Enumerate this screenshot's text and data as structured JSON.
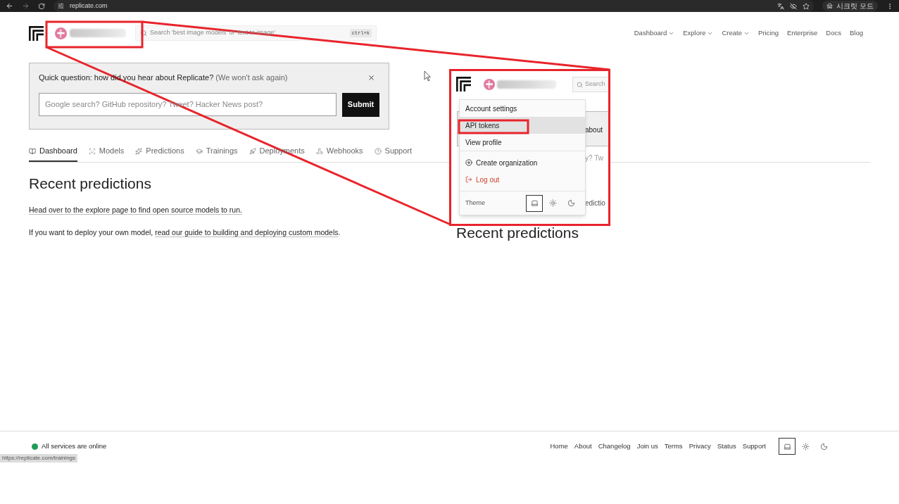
{
  "browser": {
    "url": "replicate.com",
    "profile_label": "시크릿 모드",
    "status_url": "https://replicate.com/trainings"
  },
  "header": {
    "search_placeholder": "Search 'best image models' or 'text to image'",
    "shortcut": "ctrl+k",
    "nav": [
      {
        "label": "Dashboard",
        "dropdown": true
      },
      {
        "label": "Explore",
        "dropdown": true
      },
      {
        "label": "Create",
        "dropdown": true
      },
      {
        "label": "Pricing",
        "dropdown": false
      },
      {
        "label": "Enterprise",
        "dropdown": false
      },
      {
        "label": "Docs",
        "dropdown": false
      },
      {
        "label": "Blog",
        "dropdown": false
      }
    ]
  },
  "survey": {
    "question": "Quick question: how did you hear about Replicate?",
    "note": "(We won't ask again)",
    "placeholder": "Google search? GitHub repository? Tweet? Hacker News post?",
    "submit": "Submit"
  },
  "tabs": [
    {
      "label": "Dashboard",
      "selected": true
    },
    {
      "label": "Models",
      "selected": false
    },
    {
      "label": "Predictions",
      "selected": false
    },
    {
      "label": "Trainings",
      "selected": false
    },
    {
      "label": "Deployments",
      "selected": false
    },
    {
      "label": "Webhooks",
      "selected": false
    },
    {
      "label": "Support",
      "selected": false
    }
  ],
  "content": {
    "heading": "Recent predictions",
    "explore_link": "Head over to the explore page to find open source models to run.",
    "deploy_text": "If you want to deploy your own model,",
    "deploy_link": "read our guide to building and deploying custom models",
    "deploy_end": "."
  },
  "footer": {
    "status": "All services are online",
    "links": [
      "Home",
      "About",
      "Changelog",
      "Join us",
      "Terms",
      "Privacy",
      "Status",
      "Support"
    ],
    "theme": [
      {
        "kind": "system",
        "selected": true
      },
      {
        "kind": "light",
        "selected": false
      },
      {
        "kind": "dark",
        "selected": false
      }
    ]
  },
  "inset": {
    "search": "Search",
    "fragments": [
      "about",
      "y? Tw",
      "edictio"
    ],
    "menu": [
      {
        "label": "Account settings",
        "kind": "plain",
        "highlighted": false
      },
      {
        "label": "API tokens",
        "kind": "plain",
        "highlighted": true
      },
      {
        "label": "View profile",
        "kind": "plain",
        "highlighted": false
      },
      {
        "label": "Create organization",
        "kind": "create",
        "highlighted": false
      },
      {
        "label": "Log out",
        "kind": "logout",
        "highlighted": false
      }
    ],
    "theme_label": "Theme",
    "theme": [
      {
        "kind": "system",
        "selected": true
      },
      {
        "kind": "light",
        "selected": false
      },
      {
        "kind": "dark",
        "selected": false
      }
    ],
    "heading": "Recent predictions"
  }
}
